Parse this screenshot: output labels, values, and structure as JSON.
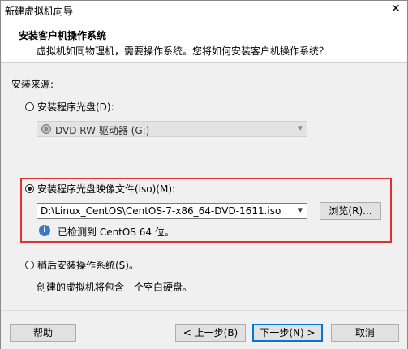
{
  "window": {
    "title": "新建虚拟机向导",
    "close_glyph": "✕"
  },
  "header": {
    "title": "安装客户机操作系统",
    "subtitle": "虚拟机如同物理机，需要操作系统。您将如何安装客户机操作系统？"
  },
  "install_source": {
    "label": "安装来源:",
    "options": [
      {
        "label": "安装程序光盘(D):",
        "selected": false
      },
      {
        "label": "安装程序光盘映像文件(iso)(M):",
        "selected": true
      },
      {
        "label": "稍后安装操作系统(S)。",
        "selected": false
      }
    ],
    "disc_drive": {
      "value": "DVD RW 驱动器 (G:)",
      "icon": "disc-drive-icon",
      "enabled": false
    },
    "iso": {
      "path": "D:\\Linux_CentOS\\CentOS-7-x86_64-DVD-1611.iso",
      "browse_label": "浏览(R)...",
      "detected_text": "已检测到 CentOS 64 位。",
      "info_icon": "info-icon",
      "info_glyph": "i"
    },
    "later_description": "创建的虚拟机将包含一个空白硬盘。"
  },
  "footer": {
    "help_label": "帮助",
    "back_label": "< 上一步(B)",
    "next_label": "下一步(N) >",
    "cancel_label": "取消"
  },
  "colors": {
    "highlight_border": "#e03030",
    "focus_border": "#0078d7",
    "info_icon_bg": "#3b78c2"
  }
}
